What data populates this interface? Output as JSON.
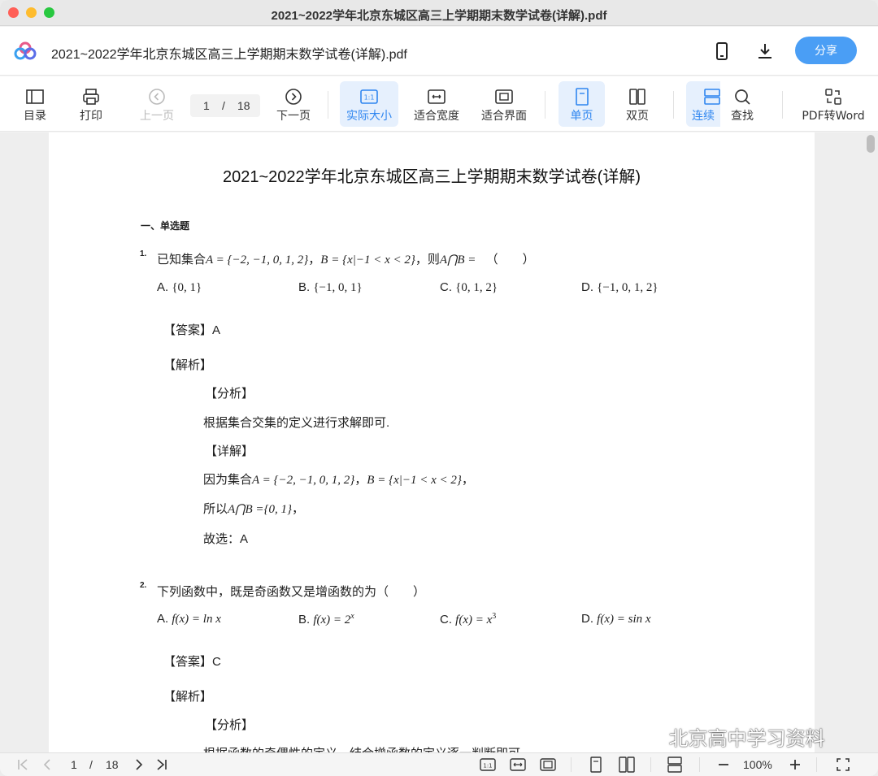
{
  "window": {
    "title": "2021~2022学年北京东城区高三上学期期末数学试卷(详解).pdf"
  },
  "header": {
    "doc_title": "2021~2022学年北京东城区高三上学期期末数学试卷(详解).pdf",
    "share_label": "分享",
    "icons": [
      "logo-icon",
      "phone-icon",
      "download-icon"
    ]
  },
  "toolbar": {
    "toc": "目录",
    "print": "打印",
    "prev": "上一页",
    "page_current": "1",
    "page_sep": "/",
    "page_total": "18",
    "next": "下一页",
    "actual_size": "实际大小",
    "fit_width": "适合宽度",
    "fit_page": "适合界面",
    "single": "单页",
    "double": "双页",
    "continuous": "连续",
    "search": "查找",
    "pdf2word": "PDF转Word",
    "accent_color": "#2f86f0"
  },
  "document": {
    "title": "2021~2022学年北京东城区高三上学期期末数学试卷(详解)",
    "section": "一、单选题",
    "q1": {
      "num": "1.",
      "stem_a": "已知集合",
      "stem_math1": "A = {−2, −1, 0, 1, 2}",
      "stem_comma": "，",
      "stem_math2": "B = {x|−1 < x < 2}",
      "stem_then": "，则",
      "stem_math3": "A⋂B =",
      "stem_paren": "（　　）",
      "opt_a_label": "A.",
      "opt_a": "{0, 1}",
      "opt_b_label": "B.",
      "opt_b": "{−1, 0, 1}",
      "opt_c_label": "C.",
      "opt_c": "{0, 1, 2}",
      "opt_d_label": "D.",
      "opt_d": "{−1, 0, 1, 2}",
      "answer": "【答案】A",
      "analysis_head": "【解析】",
      "fenxi": "【分析】",
      "fenxi_text": "根据集合交集的定义进行求解即可.",
      "xiangjie": "【详解】",
      "step1_text": "因为集合",
      "step1_math1": "A = {−2, −1, 0, 1, 2}",
      "step1_comma": "，",
      "step1_math2": "B = {x|−1 < x < 2}",
      "step1_end": "，",
      "step2_text": "所以",
      "step2_math": "A⋂B ={0, 1}",
      "step2_end": "，",
      "step3": "故选：A"
    },
    "q2": {
      "num": "2.",
      "stem": "下列函数中，既是奇函数又是增函数的为（　　）",
      "opt_a_label": "A.",
      "opt_a": "f(x) = ln x",
      "opt_b_label": "B.",
      "opt_b": "f(x) = 2",
      "opt_b_sup": "x",
      "opt_c_label": "C.",
      "opt_c": "f(x) = x",
      "opt_c_sup": "3",
      "opt_d_label": "D.",
      "opt_d": "f(x) = sin x",
      "answer": "【答案】C",
      "analysis_head": "【解析】",
      "fenxi": "【分析】",
      "fenxi_text": "根据函数的奇偶性的定义，结合增函数的定义逐一判断即可."
    }
  },
  "watermark": "北京高中学习资料",
  "statusbar": {
    "page_current": "1",
    "page_sep": "/",
    "page_total": "18",
    "zoom": "100%"
  }
}
